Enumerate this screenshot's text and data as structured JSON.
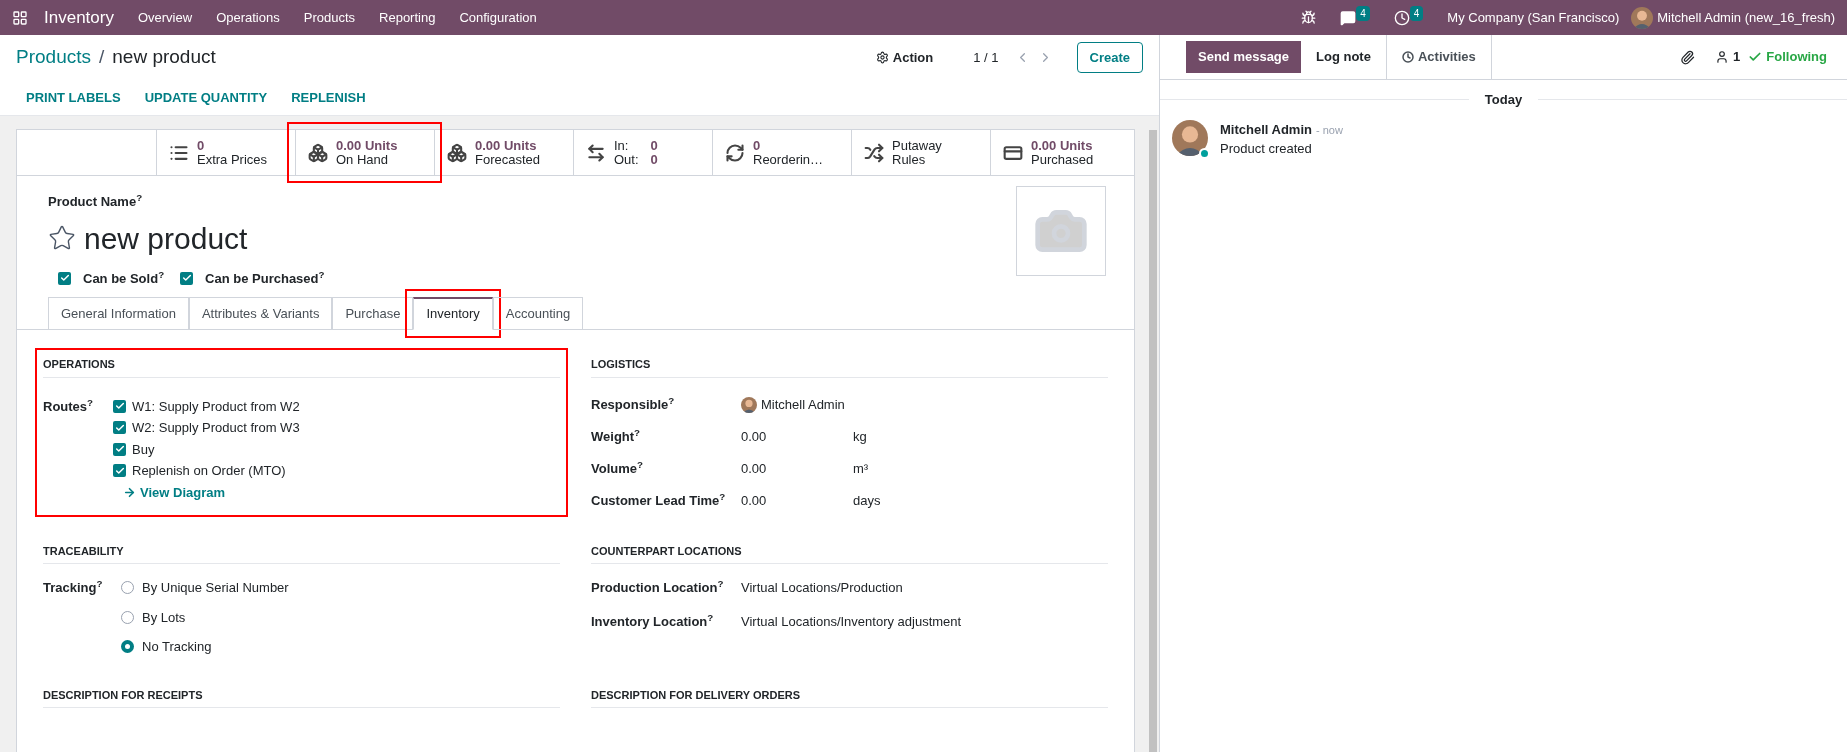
{
  "navbar": {
    "app": "Inventory",
    "menu": [
      "Overview",
      "Operations",
      "Products",
      "Reporting",
      "Configuration"
    ],
    "messages_count": "4",
    "activities_count": "4",
    "company": "My Company (San Francisco)",
    "user": "Mitchell Admin (new_16_fresh)"
  },
  "breadcrumb": {
    "parent": "Products",
    "separator": "/",
    "current": "new product"
  },
  "action": "Action",
  "pager": "1 / 1",
  "create": "Create",
  "action_buttons": [
    "PRINT LABELS",
    "UPDATE QUANTITY",
    "REPLENISH"
  ],
  "stats": [
    {
      "kind": "single",
      "value": "0",
      "label": "Extra Prices",
      "highlighted": false
    },
    {
      "kind": "single",
      "value": "0.00 Units",
      "label": "On Hand",
      "highlighted": true
    },
    {
      "kind": "single",
      "value": "0.00 Units",
      "label": "Forecasted",
      "highlighted": false
    },
    {
      "kind": "inout",
      "in_label": "In:",
      "in_value": "0",
      "out_label": "Out:",
      "out_value": "0",
      "highlighted": false
    },
    {
      "kind": "single",
      "value": "0",
      "label": "Reorderin…",
      "highlighted": false
    },
    {
      "kind": "plain",
      "value": "Putaway",
      "label": "Rules",
      "highlighted": false
    },
    {
      "kind": "single",
      "value": "0.00 Units",
      "label": "Purchased",
      "highlighted": false
    }
  ],
  "product": {
    "name_label": "Product Name$^{?}$",
    "name": "new product",
    "favorite": false,
    "options": [
      {
        "label": "Can be Sold$^{?}$",
        "checked": true
      },
      {
        "label": "Can be Purchased$^{?}$",
        "checked": true
      }
    ]
  },
  "tabs": [
    {
      "label": "General Information",
      "selected": false,
      "highlighted": false
    },
    {
      "label": "Attributes & Variants",
      "selected": false,
      "highlighted": false
    },
    {
      "label": "Purchase",
      "selected": false,
      "highlighted": false
    },
    {
      "label": "Inventory",
      "selected": true,
      "highlighted": true
    },
    {
      "label": "Accounting",
      "selected": false,
      "highlighted": false
    }
  ],
  "operations": {
    "title": "OPERATIONS",
    "highlighted": true,
    "routes_label": "Routes$^{?}$",
    "routes": [
      {
        "label": "W1: Supply Product from W2",
        "checked": true
      },
      {
        "label": "W2: Supply Product from W3",
        "checked": true
      },
      {
        "label": "Buy",
        "checked": true
      },
      {
        "label": "Replenish on Order (MTO)",
        "checked": true
      }
    ],
    "link": "View Diagram"
  },
  "logistics": {
    "title": "LOGISTICS",
    "fields": [
      {
        "kind": "user",
        "label": "Responsible$^{?}$",
        "value": "Mitchell Admin"
      },
      {
        "kind": "unit",
        "label": "Weight$^{?}$",
        "value": "0.00",
        "unit": "kg"
      },
      {
        "kind": "unit",
        "label": "Volume$^{?}$",
        "value": "0.00",
        "unit": "m³"
      },
      {
        "kind": "unit",
        "label": "Customer Lead Time$^{?}$",
        "value": "0.00",
        "unit": "days"
      }
    ]
  },
  "traceability": {
    "title": "TRACEABILITY",
    "label": "Tracking$^{?}$",
    "options": [
      {
        "label": "By Unique Serial Number",
        "selected": false
      },
      {
        "label": "By Lots",
        "selected": false
      },
      {
        "label": "No Tracking",
        "selected": true
      }
    ]
  },
  "counterpart": {
    "title": "COUNTERPART LOCATIONS",
    "fields": [
      {
        "label": "Production Location$^{?}$",
        "value": "Virtual Locations/Production"
      },
      {
        "label": "Inventory Location$^{?}$",
        "value": "Virtual Locations/Inventory adjustment"
      }
    ]
  },
  "descriptions": [
    "DESCRIPTION FOR RECEIPTS",
    "DESCRIPTION FOR DELIVERY ORDERS"
  ],
  "chatter": {
    "buttons": [
      {
        "kind": "primary",
        "label": "Send message",
        "selected": false
      },
      {
        "kind": "tab",
        "label": "Log note",
        "selected": true
      },
      {
        "kind": "activities",
        "label": "Activities",
        "selected": false
      }
    ],
    "followers": "1",
    "following": "Following",
    "date": "Today",
    "messages": [
      {
        "author": "Mitchell Admin",
        "time": "- now",
        "body": "Product created",
        "online": true
      }
    ]
  }
}
